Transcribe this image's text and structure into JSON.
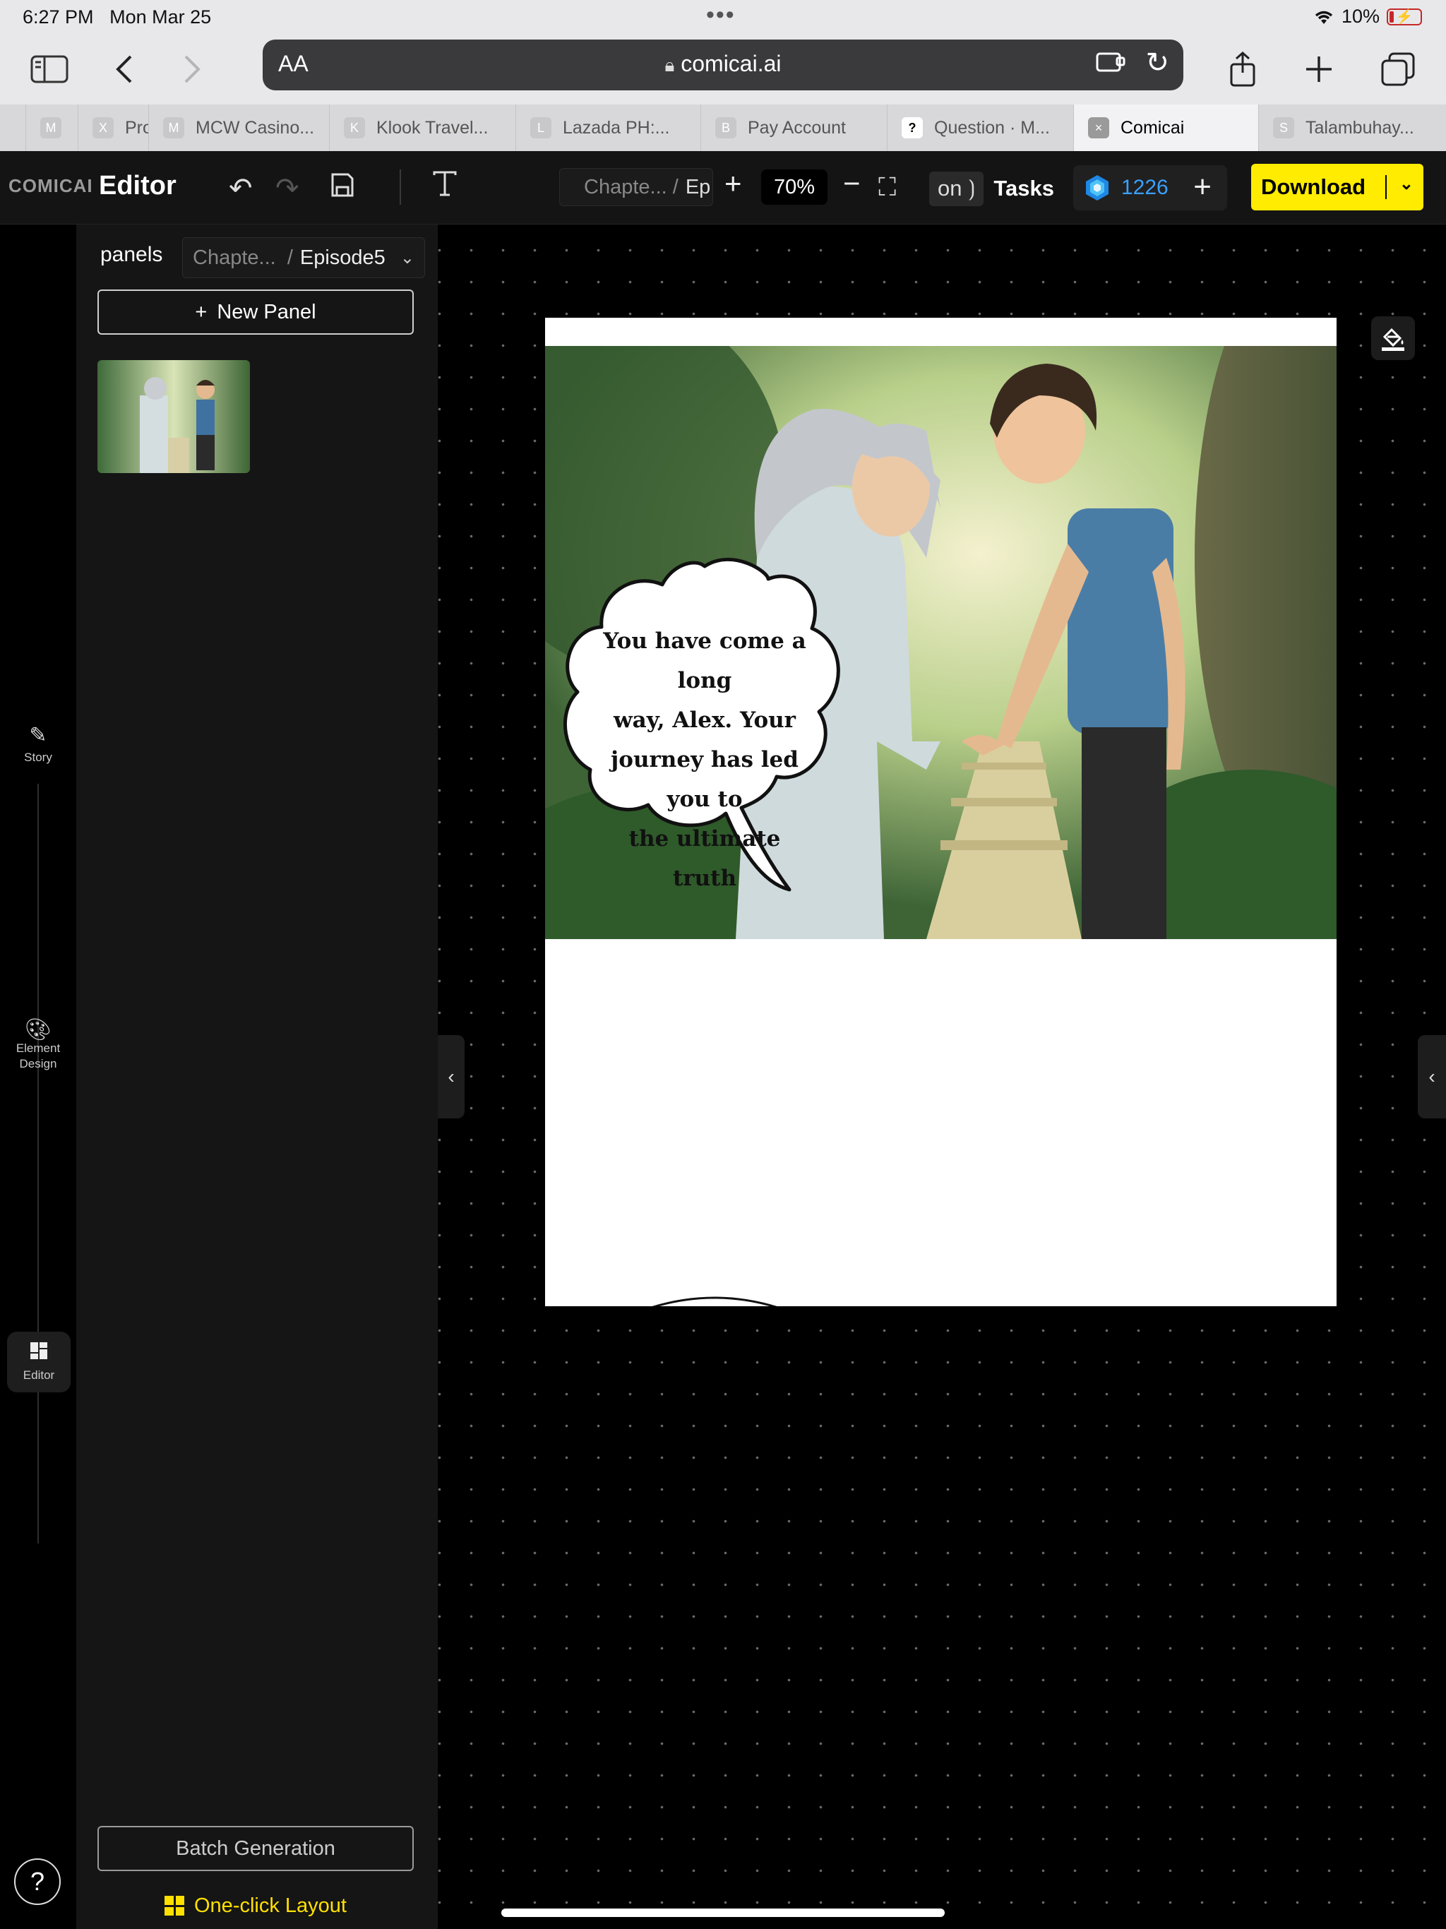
{
  "status": {
    "time": "6:27 PM",
    "date": "Mon Mar 25",
    "battery": "10%"
  },
  "browser": {
    "aa": "AA",
    "url": "comicai.ai",
    "tabs": [
      {
        "fav": "M",
        "label": ""
      },
      {
        "fav": "X",
        "label": "Pro"
      },
      {
        "fav": "M",
        "label": "MCW Casino..."
      },
      {
        "fav": "K",
        "label": "Klook Travel..."
      },
      {
        "fav": "L",
        "label": "Lazada PH:..."
      },
      {
        "fav": "B",
        "label": "Pay Account"
      },
      {
        "fav": "?",
        "label": "Question · M..."
      },
      {
        "fav": "×",
        "label": "Comicai"
      },
      {
        "fav": "S",
        "label": "Talambuhay..."
      }
    ]
  },
  "header": {
    "logo": "COMICAI",
    "title": "Editor",
    "breadcrumb_parent": "Chapte...",
    "breadcrumb_sep": "/",
    "breadcrumb_current": "Ep",
    "zoom": "70%",
    "tasks_fragment": "on ⟯",
    "tasks_label": "Tasks",
    "credits": "1226",
    "download_label": "Download"
  },
  "rail": {
    "story": "Story",
    "element_design": "Element Design",
    "editor": "Editor",
    "help": "?"
  },
  "sidebar": {
    "title": "panels",
    "crumb_parent": "Chapte...",
    "crumb_sep": "/",
    "crumb_current": "Episode5",
    "new_panel": "New Panel",
    "batch": "Batch Generation",
    "one_click": "One-click Layout"
  },
  "canvas": {
    "speech_lines": [
      "You have come a long",
      "way, Alex. Your",
      "journey has led you to",
      "the ultimate truth"
    ]
  }
}
